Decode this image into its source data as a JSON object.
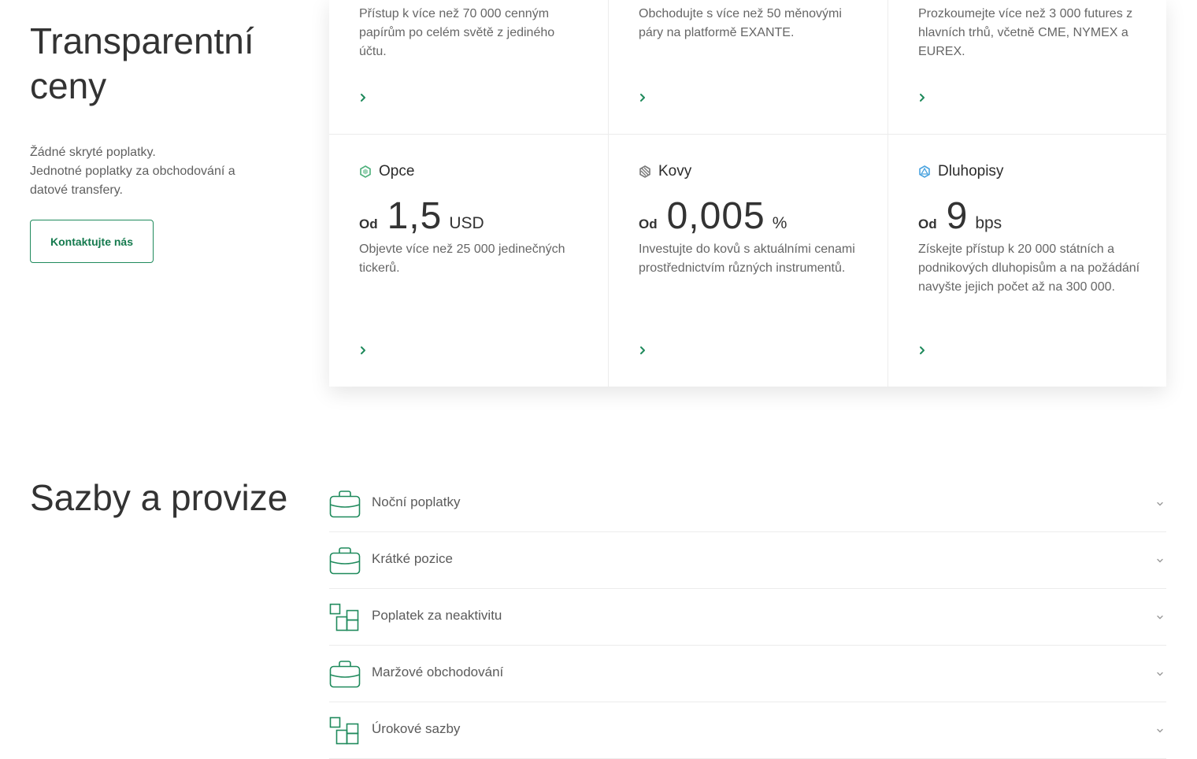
{
  "intro": {
    "title": "Transparentní ceny",
    "description_line1": "Žádné skryté poplatky.",
    "description_line2": "Jednotné poplatky za obchodování a datové transfery.",
    "contact_label": "Kontaktujte nás"
  },
  "colors": {
    "accent": "#1f8a5c",
    "options_icon": "#4caf7a",
    "bonds_icon": "#4aa3df"
  },
  "cards_top": [
    {
      "description": "Přístup k více než 70 000 cenným papírům po celém světě z jediného účtu.",
      "arrow_icon": "chevron-right-icon"
    },
    {
      "description": "Obchodujte s více než 50 měnovými páry na platformě EXANTE.",
      "arrow_icon": "chevron-right-icon"
    },
    {
      "description": "Prozkoumejte více než 3 000 futures z hlavních trhů, včetně CME, NYMEX a EUREX.",
      "arrow_icon": "chevron-right-icon"
    }
  ],
  "cards_bottom": [
    {
      "name": "Opce",
      "icon": "options-icon",
      "od": "Od",
      "value": "1,5",
      "unit": "USD",
      "description": "Objevte více než 25 000 jedinečných tickerů.",
      "arrow_icon": "chevron-right-icon"
    },
    {
      "name": "Kovy",
      "icon": "metals-icon",
      "od": "Od",
      "value": "0,005",
      "unit": "%",
      "description": "Investujte do kovů s aktuálními cenami prostřednictvím různých instrumentů.",
      "arrow_icon": "chevron-right-icon"
    },
    {
      "name": "Dluhopisy",
      "icon": "bonds-icon",
      "od": "Od",
      "value": "9",
      "unit": "bps",
      "description": "Získejte přístup k 20 000 státních a podnikových dluhopisům a na požádání navyšte jejich počet až na 300 000.",
      "arrow_icon": "chevron-right-icon"
    }
  ],
  "rates": {
    "title": "Sazby a provize",
    "items": [
      {
        "label": "Noční poplatky",
        "icon": "briefcase-icon"
      },
      {
        "label": "Krátké pozice",
        "icon": "briefcase-icon"
      },
      {
        "label": "Poplatek za neaktivitu",
        "icon": "squares-icon"
      },
      {
        "label": "Maržové obchodování",
        "icon": "briefcase-icon"
      },
      {
        "label": "Úrokové sazby",
        "icon": "squares-icon"
      }
    ]
  }
}
